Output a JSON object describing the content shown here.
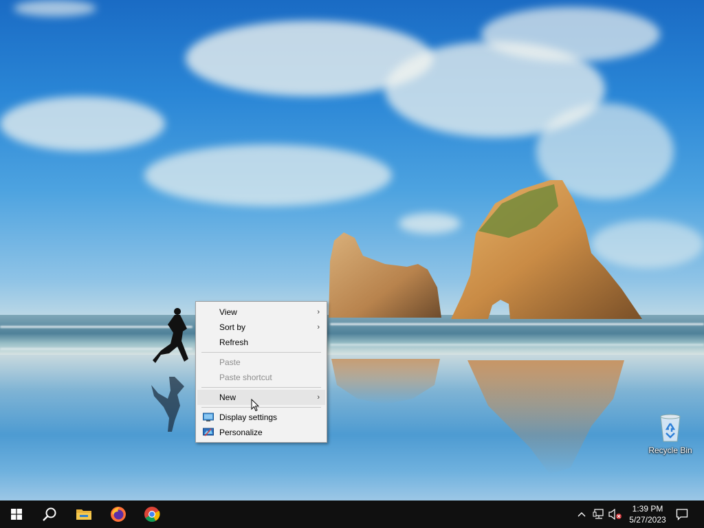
{
  "context_menu": {
    "items": [
      {
        "label": "View",
        "has_submenu": true,
        "enabled": true
      },
      {
        "label": "Sort by",
        "has_submenu": true,
        "enabled": true
      },
      {
        "label": "Refresh",
        "has_submenu": false,
        "enabled": true
      },
      {
        "label": "Paste",
        "has_submenu": false,
        "enabled": false
      },
      {
        "label": "Paste shortcut",
        "has_submenu": false,
        "enabled": false
      },
      {
        "label": "New",
        "has_submenu": true,
        "enabled": true,
        "highlighted": true
      },
      {
        "label": "Display settings",
        "has_submenu": false,
        "enabled": true,
        "icon": "display-icon"
      },
      {
        "label": "Personalize",
        "has_submenu": false,
        "enabled": true,
        "icon": "personalize-icon"
      }
    ],
    "submenu_arrow": "›"
  },
  "desktop": {
    "icons": [
      {
        "label": "Recycle Bin",
        "icon": "recycle-bin-icon"
      }
    ]
  },
  "taskbar": {
    "pinned": [
      {
        "name": "Start",
        "icon": "windows-logo-icon"
      },
      {
        "name": "Search",
        "icon": "search-icon"
      },
      {
        "name": "File Explorer",
        "icon": "folder-icon"
      },
      {
        "name": "Firefox",
        "icon": "firefox-icon"
      },
      {
        "name": "Chrome",
        "icon": "chrome-icon"
      }
    ],
    "tray": {
      "icons": [
        "chevron-up-icon",
        "network-icon",
        "volume-muted-icon",
        "notification-icon"
      ],
      "time": "1:39 PM",
      "date": "5/27/2023"
    }
  },
  "colors": {
    "taskbar_bg": "#101010",
    "menu_bg": "#f2f2f2",
    "menu_hover": "#e5e5e5",
    "disabled_text": "#8d8d8d"
  }
}
